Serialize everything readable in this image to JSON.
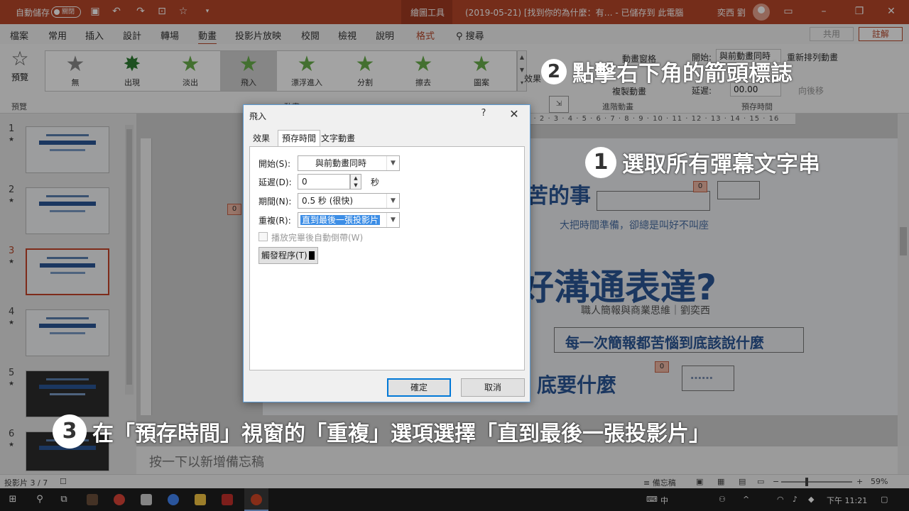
{
  "titlebar": {
    "autosave_label": "自動儲存",
    "autosave_state": "關閉",
    "context_tab": "繪圖工具",
    "document_title": "(2019-05-21) [找到你的為什麼：有…  -  已儲存到 此電腦",
    "user_name": "奕西 劉"
  },
  "tabs": [
    "檔案",
    "常用",
    "插入",
    "設計",
    "轉場",
    "動畫",
    "投影片放映",
    "校閱",
    "檢視",
    "說明",
    "格式"
  ],
  "search_label": "搜尋",
  "share_label": "共用",
  "comment_label": "註解",
  "ribbon": {
    "preview_label": "預覽",
    "preview_group": "預覽",
    "animations": [
      "無",
      "出現",
      "淡出",
      "飛入",
      "漂浮進入",
      "分割",
      "擦去",
      "圖案"
    ],
    "effect_options": "效果",
    "add_animation_pane": "動畫窗格",
    "start_label": "開始:",
    "start_value": "與前動畫同時",
    "reorder_label": "重新排列動畫",
    "delay_label": "延遲:",
    "delay_value": "00.00",
    "move_later": "向後移",
    "copy_animation": "複製動畫",
    "advanced_group": "進階動畫",
    "timing_group": "預存時間",
    "animation_group": "動畫",
    "ruler_ticks": "1 · 2 · 3 · 4 · 5 · 6 · 7 · 8 · 9 · 10 · 11 · 12 · 13 · 14 · 15 · 16"
  },
  "slides": [
    {
      "num": "1",
      "mark": "★"
    },
    {
      "num": "2",
      "mark": "★"
    },
    {
      "num": "3",
      "mark": "★"
    },
    {
      "num": "4",
      "mark": "★"
    },
    {
      "num": "5",
      "mark": "★"
    },
    {
      "num": "6",
      "mark": "★"
    }
  ],
  "slide_canvas": {
    "text_thing": "苦的事",
    "text_sub": "大把時間準備，卻總是叫好不叫座",
    "title": "好溝通表達?",
    "author": "職人簡報與商業思維｜劉奕西",
    "line1": "每一次簡報都苦惱到底該說什麼",
    "line2": "底要什麼",
    "line3": "……",
    "tag": "0"
  },
  "notes_placeholder": "按一下以新增備忘稿",
  "status": {
    "slide_indicator": "投影片 3 / 7",
    "notes_label": "備忘稿",
    "zoom": "59%"
  },
  "taskbar": {
    "ime": "中",
    "time": "下午 11:21"
  },
  "dialog": {
    "title": "飛入",
    "help": "?",
    "tabs": [
      "效果",
      "預存時間",
      "文字動畫"
    ],
    "start_label": "開始(S):",
    "start_value": "與前動畫同時",
    "delay_label": "延遲(D):",
    "delay_value": "0",
    "delay_unit": "秒",
    "duration_label": "期間(N):",
    "duration_value": "0.5 秒 (很快)",
    "repeat_label": "重複(R):",
    "repeat_value": "直到最後一張投影片",
    "rewind_label": "播放完畢後自動倒帶(W)",
    "trigger_label": "觸發程序(T)",
    "ok_label": "確定",
    "cancel_label": "取消"
  },
  "annotations": [
    {
      "num": "1",
      "text": "選取所有彈幕文字串"
    },
    {
      "num": "2",
      "text": "點擊右下角的箭頭標誌"
    },
    {
      "num": "3",
      "text": "在「預存時間」視窗的「重複」選項選擇「直到最後一張投影片」"
    }
  ],
  "colors": {
    "accent": "#b7472a",
    "slide_text": "#2b5797",
    "dialog_border": "#5b9bd5"
  }
}
